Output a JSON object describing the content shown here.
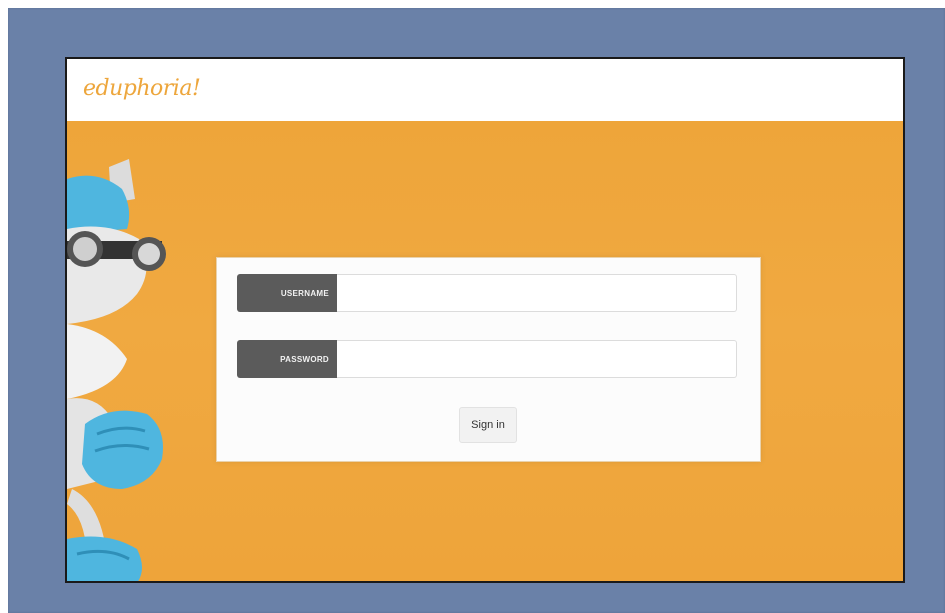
{
  "app": {
    "logo_text": "eduphoria!"
  },
  "login": {
    "username_label": "USERNAME",
    "username_value": "",
    "password_label": "PASSWORD",
    "password_value": "",
    "sign_in_label": "Sign in"
  },
  "colors": {
    "frame_bg": "#6a81a8",
    "brand_orange": "#eea43a",
    "logo_orange": "#eda63c",
    "label_gray": "#5b5b5b",
    "mascot_blue": "#4fb6df"
  },
  "icons": {
    "mascot": "fox-mascot-with-goggles"
  }
}
